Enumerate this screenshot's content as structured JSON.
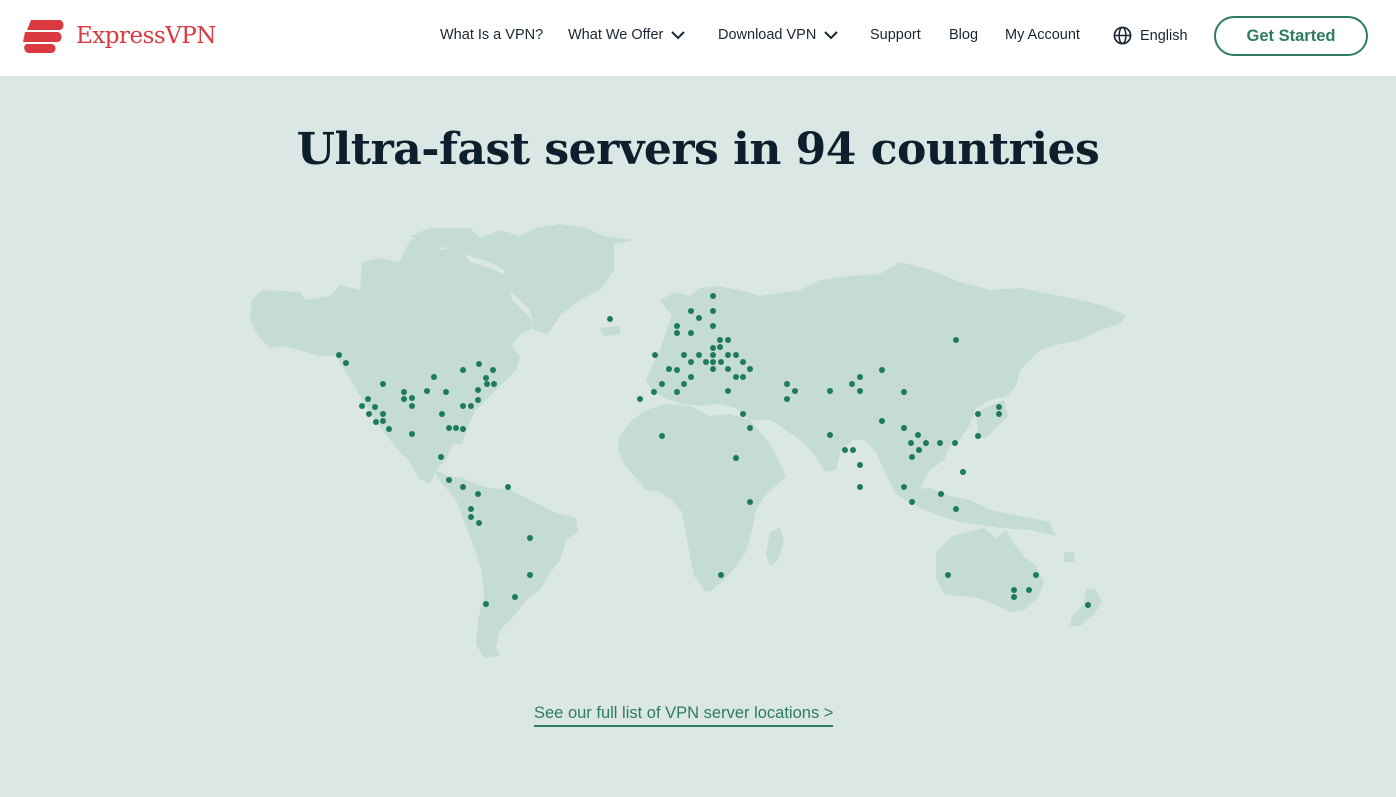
{
  "header": {
    "brand": "ExpressVPN",
    "nav": [
      {
        "label": "What Is a VPN?",
        "has_dropdown": false
      },
      {
        "label": "What We Offer",
        "has_dropdown": true
      },
      {
        "label": "Download VPN",
        "has_dropdown": true
      },
      {
        "label": "Support",
        "has_dropdown": false
      },
      {
        "label": "Blog",
        "has_dropdown": false
      },
      {
        "label": "My Account",
        "has_dropdown": false
      }
    ],
    "language": {
      "icon": "globe-icon",
      "label": "English"
    },
    "cta_label": "Get Started"
  },
  "main": {
    "title": "Ultra-fast servers in 94 countries",
    "map": {
      "land_color": "#c5dbd5",
      "dot_color": "#1d7a5c",
      "background": "#dae7e5"
    },
    "link_label": "See our full list of VPN server locations >"
  },
  "colors": {
    "brand_red": "#da3940",
    "accent_green": "#2f7a64",
    "text_dark": "#0d1f2d"
  }
}
